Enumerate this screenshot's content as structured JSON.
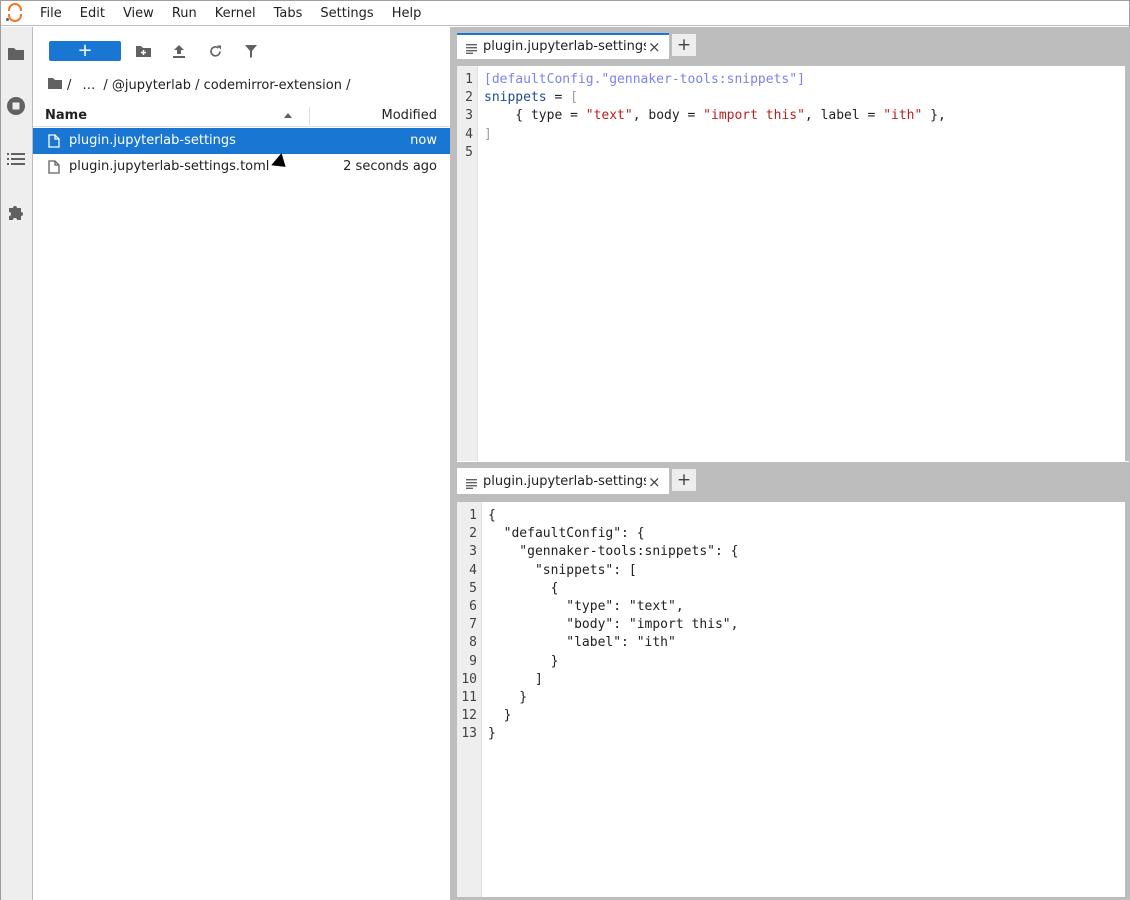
{
  "menu": [
    "File",
    "Edit",
    "View",
    "Run",
    "Kernel",
    "Tabs",
    "Settings",
    "Help"
  ],
  "sidebar_icons": [
    "folder-icon",
    "running-icon",
    "toc-icon",
    "extension-icon"
  ],
  "filebrowser": {
    "new_label": "+",
    "breadcrumbs": [
      "/",
      "…",
      "/ @jupyterlab / codemirror-extension /"
    ],
    "header": {
      "name": "Name",
      "modified": "Modified"
    },
    "rows": [
      {
        "name": "plugin.jupyterlab-settings",
        "modified": "now",
        "selected": true
      },
      {
        "name": "plugin.jupyterlab-settings.toml",
        "modified": "2 seconds ago",
        "selected": false
      }
    ]
  },
  "top_panel": {
    "tab_label": "plugin.jupyterlab-settings.toml",
    "close": "×",
    "add": "+",
    "line_numbers": [
      "1",
      "2",
      "3",
      "4",
      "5"
    ],
    "code": {
      "l1": "[defaultConfig.\"gennaker-tools:snippets\"]",
      "l2_key": "snippets",
      "l2_rest": " = ",
      "l2_bracket": "[",
      "l3_a": "    { type = ",
      "l3_s1": "\"text\"",
      "l3_b": ", body = ",
      "l3_s2": "\"import this\"",
      "l3_c": ", label = ",
      "l3_s3": "\"ith\"",
      "l3_d": " },",
      "l4": "]",
      "l5": ""
    }
  },
  "bottom_panel": {
    "tab_label": "plugin.jupyterlab-settings",
    "close": "×",
    "add": "+",
    "line_numbers": [
      "1",
      "2",
      "3",
      "4",
      "5",
      "6",
      "7",
      "8",
      "9",
      "10",
      "11",
      "12",
      "13"
    ],
    "code": [
      "{",
      "  \"defaultConfig\": {",
      "    \"gennaker-tools:snippets\": {",
      "      \"snippets\": [",
      "        {",
      "          \"type\": \"text\",",
      "          \"body\": \"import this\",",
      "          \"label\": \"ith\"",
      "        }",
      "      ]",
      "    }",
      "  }",
      "}"
    ]
  }
}
